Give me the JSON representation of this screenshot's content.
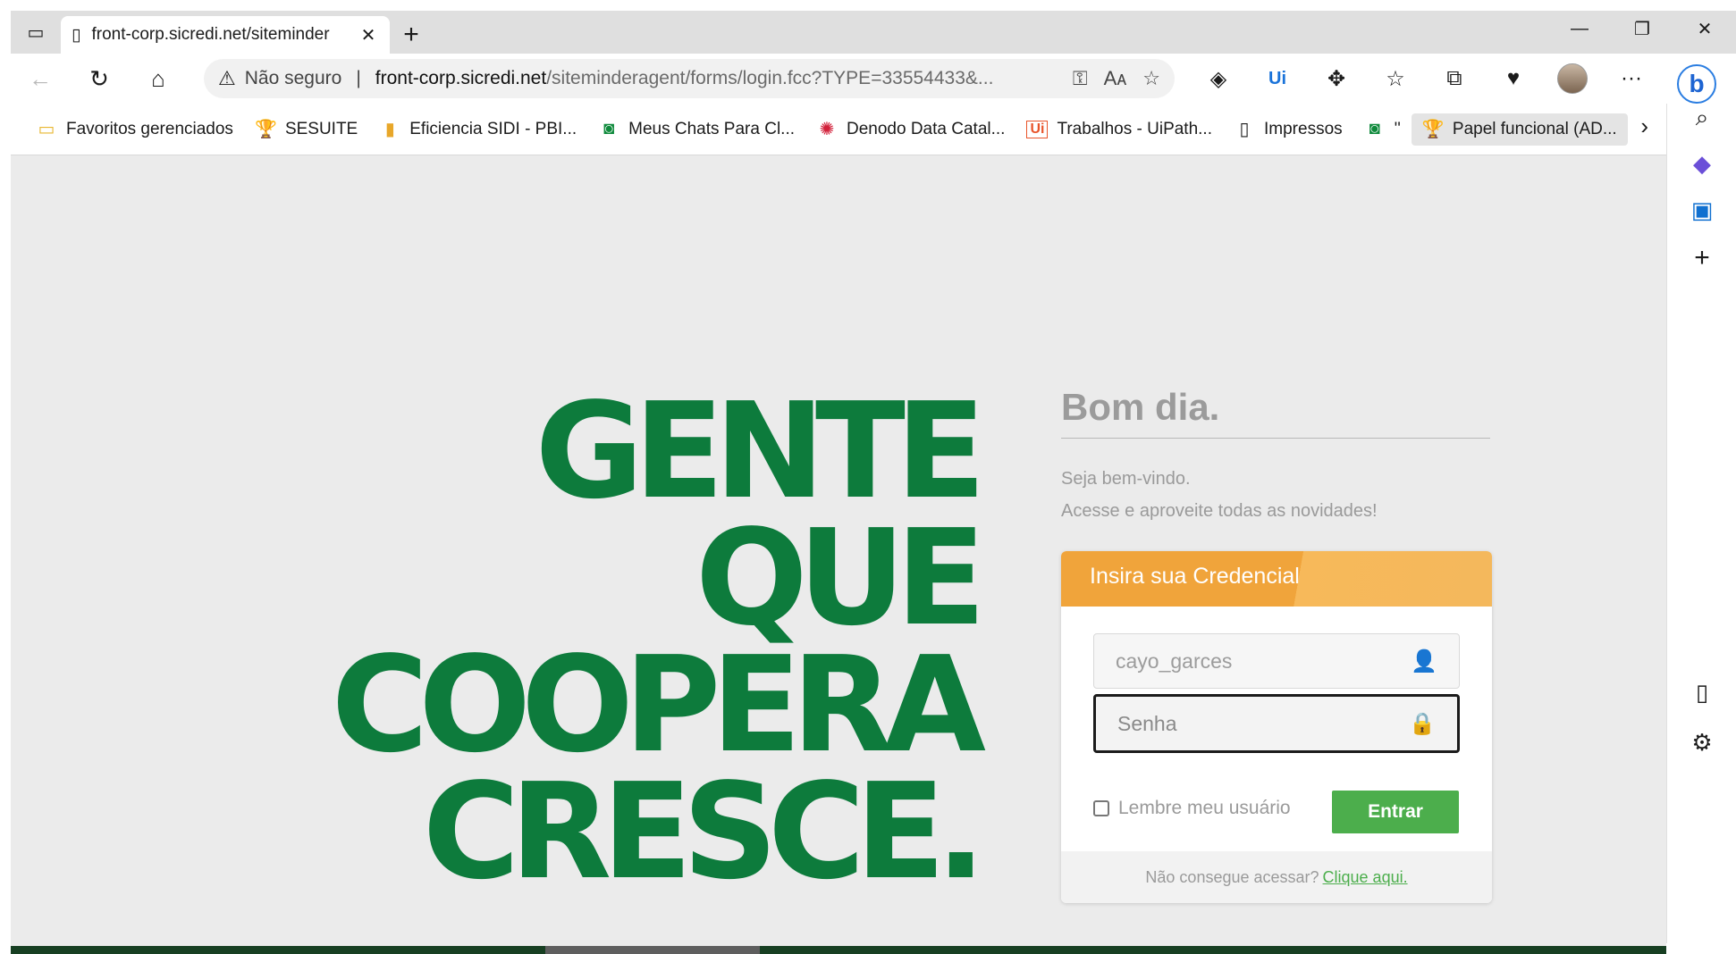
{
  "tab": {
    "title": "front-corp.sicredi.net/siteminder",
    "close": "✕"
  },
  "newtab": "+",
  "window_controls": {
    "minimize": "—",
    "restore": "❐",
    "close": "✕"
  },
  "nav": {
    "back": "←",
    "refresh": "↻",
    "home": "⌂"
  },
  "address": {
    "warning_icon": "⚠",
    "not_secure": "Não seguro",
    "separator": "|",
    "host": "front-corp.sicredi.net",
    "path": "/siteminderagent/forms/login.fcc?TYPE=33554433&...",
    "key_icon": "⚿",
    "read_aloud": "Aᴀ",
    "fav_add": "☆"
  },
  "tools": {
    "t1": "◈",
    "t2": "Ui",
    "t3": "✥",
    "t4": "☆",
    "t5": "⧉",
    "t6": "♥",
    "more": "···"
  },
  "bing": "b",
  "bookmarks": [
    {
      "icon": "▭",
      "label": "Favoritos gerenciados"
    },
    {
      "icon": "🏆",
      "label": "SESUITE"
    },
    {
      "icon": "▮",
      "label": "Eficiencia SIDI - PBI..."
    },
    {
      "icon": "◙",
      "label": "Meus Chats Para Cl..."
    },
    {
      "icon": "✺",
      "label": "Denodo Data Catal..."
    },
    {
      "icon": "Ui",
      "label": "Trabalhos - UiPath..."
    },
    {
      "icon": "▯",
      "label": "Impressos"
    },
    {
      "icon": "◙",
      "label": "''"
    },
    {
      "icon": "🏆",
      "label": "Papel funcional (AD..."
    }
  ],
  "bookmarks_more": "›",
  "sidebar": {
    "search": "⌕",
    "copilot": "◆",
    "outlook": "▣",
    "add": "+",
    "split": "▯",
    "settings": "⚙"
  },
  "page": {
    "slogan": [
      "GENTE",
      "QUE",
      "COOPERA",
      "CRESCE."
    ],
    "greeting": "Bom dia.",
    "welcome_line1": "Seja bem-vindo.",
    "welcome_line2": "Acesse e aproveite todas as novidades!",
    "card_title": "Insira sua Credencial",
    "username_value": "cayo_garces",
    "user_icon": "👤",
    "password_placeholder": "Senha",
    "lock_icon": "🔒",
    "remember_label": "Lembre meu usuário",
    "submit_label": "Entrar",
    "help_text": "Não consegue acessar?",
    "help_link": "Clique aqui."
  }
}
